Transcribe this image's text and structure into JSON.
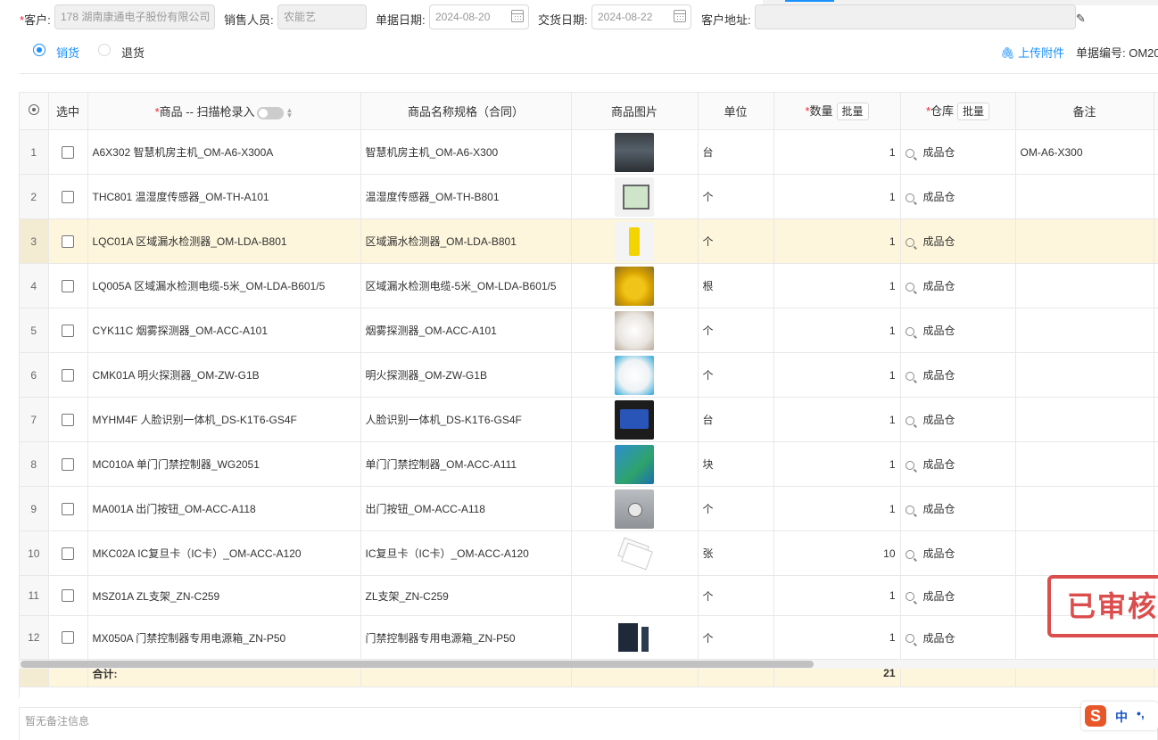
{
  "form": {
    "customer_label": "客户:",
    "customer_value": "178 湖南康通电子股份有限公司",
    "sales_label": "销售人员:",
    "sales_value": "农能艺",
    "doc_date_label": "单据日期:",
    "doc_date_value": "2024-08-20",
    "delivery_date_label": "交货日期:",
    "delivery_date_value": "2024-08-22",
    "address_label": "客户地址:",
    "address_value": ""
  },
  "mode": {
    "sale_label": "销货",
    "return_label": "退货",
    "selected": "销货",
    "upload_label": "上传附件",
    "doc_no_label": "单据编号: OM20"
  },
  "columns": {
    "select": "选中",
    "product": "商品 -- 扫描枪录入",
    "spec": "商品名称规格（合同）",
    "image": "商品图片",
    "unit": "单位",
    "qty": "数量",
    "warehouse": "仓库",
    "remark": "备注",
    "batch": "批量"
  },
  "rows": [
    {
      "no": "1",
      "product": "A6X302 智慧机房主机_OM-A6-X300A",
      "spec": "智慧机房主机_OM-A6-X300",
      "unit": "台",
      "qty": "1",
      "warehouse": "成品仓",
      "remark": "OM-A6-X300",
      "image": "server-host-photo",
      "highlighted": false
    },
    {
      "no": "2",
      "product": "THC801 温湿度传感器_OM-TH-A101",
      "spec": "温湿度传感器_OM-TH-B801",
      "unit": "个",
      "qty": "1",
      "warehouse": "成品仓",
      "remark": "",
      "image": "humidity-sensor-photo",
      "highlighted": false
    },
    {
      "no": "3",
      "product": "LQC01A 区域漏水检测器_OM-LDA-B801",
      "spec": "区域漏水检测器_OM-LDA-B801",
      "unit": "个",
      "qty": "1",
      "warehouse": "成品仓",
      "remark": "",
      "image": "leak-detector-photo",
      "highlighted": true
    },
    {
      "no": "4",
      "product": "LQ005A 区域漏水检测电缆-5米_OM-LDA-B601/5",
      "spec": "区域漏水检测电缆-5米_OM-LDA-B601/5",
      "unit": "根",
      "qty": "1",
      "warehouse": "成品仓",
      "remark": "",
      "image": "leak-cable-photo",
      "highlighted": false
    },
    {
      "no": "5",
      "product": "CYK11C 烟雾探测器_OM-ACC-A101",
      "spec": "烟雾探测器_OM-ACC-A101",
      "unit": "个",
      "qty": "1",
      "warehouse": "成品仓",
      "remark": "",
      "image": "smoke-detector-photo",
      "highlighted": false
    },
    {
      "no": "6",
      "product": "CMK01A 明火探测器_OM-ZW-G1B",
      "spec": "明火探测器_OM-ZW-G1B",
      "unit": "个",
      "qty": "1",
      "warehouse": "成品仓",
      "remark": "",
      "image": "flame-detector-photo",
      "highlighted": false
    },
    {
      "no": "7",
      "product": "MYHM4F 人脸识别一体机_DS-K1T6-GS4F",
      "spec": "人脸识别一体机_DS-K1T6-GS4F",
      "unit": "台",
      "qty": "1",
      "warehouse": "成品仓",
      "remark": "",
      "image": "face-terminal-photo",
      "highlighted": false
    },
    {
      "no": "8",
      "product": "MC010A 单门门禁控制器_WG2051",
      "spec": "单门门禁控制器_OM-ACC-A111",
      "unit": "块",
      "qty": "1",
      "warehouse": "成品仓",
      "remark": "",
      "image": "controller-board-photo",
      "highlighted": false
    },
    {
      "no": "9",
      "product": "MA001A 出门按钮_OM-ACC-A118",
      "spec": "出门按钮_OM-ACC-A118",
      "unit": "个",
      "qty": "1",
      "warehouse": "成品仓",
      "remark": "",
      "image": "exit-button-photo",
      "highlighted": false
    },
    {
      "no": "10",
      "product": "MKC02A IC复旦卡（IC卡）_OM-ACC-A120",
      "spec": "IC复旦卡（IC卡）_OM-ACC-A120",
      "unit": "张",
      "qty": "10",
      "warehouse": "成品仓",
      "remark": "",
      "image": "ic-card-photo",
      "highlighted": false
    },
    {
      "no": "11",
      "product": "MSZ01A ZL支架_ZN-C259",
      "spec": "ZL支架_ZN-C259",
      "unit": "个",
      "qty": "1",
      "warehouse": "成品仓",
      "remark": "",
      "image": "",
      "highlighted": false
    },
    {
      "no": "12",
      "product": "MX050A 门禁控制器专用电源箱_ZN-P50",
      "spec": "门禁控制器专用电源箱_ZN-P50",
      "unit": "个",
      "qty": "1",
      "warehouse": "成品仓",
      "remark": "",
      "image": "power-box-photo",
      "highlighted": false
    }
  ],
  "footer": {
    "label": "合计:",
    "qty_total": "21"
  },
  "stamp": "已审核",
  "remark_placeholder": "暂无备注信息",
  "ime": {
    "mode": "中",
    "punct": "•,"
  }
}
